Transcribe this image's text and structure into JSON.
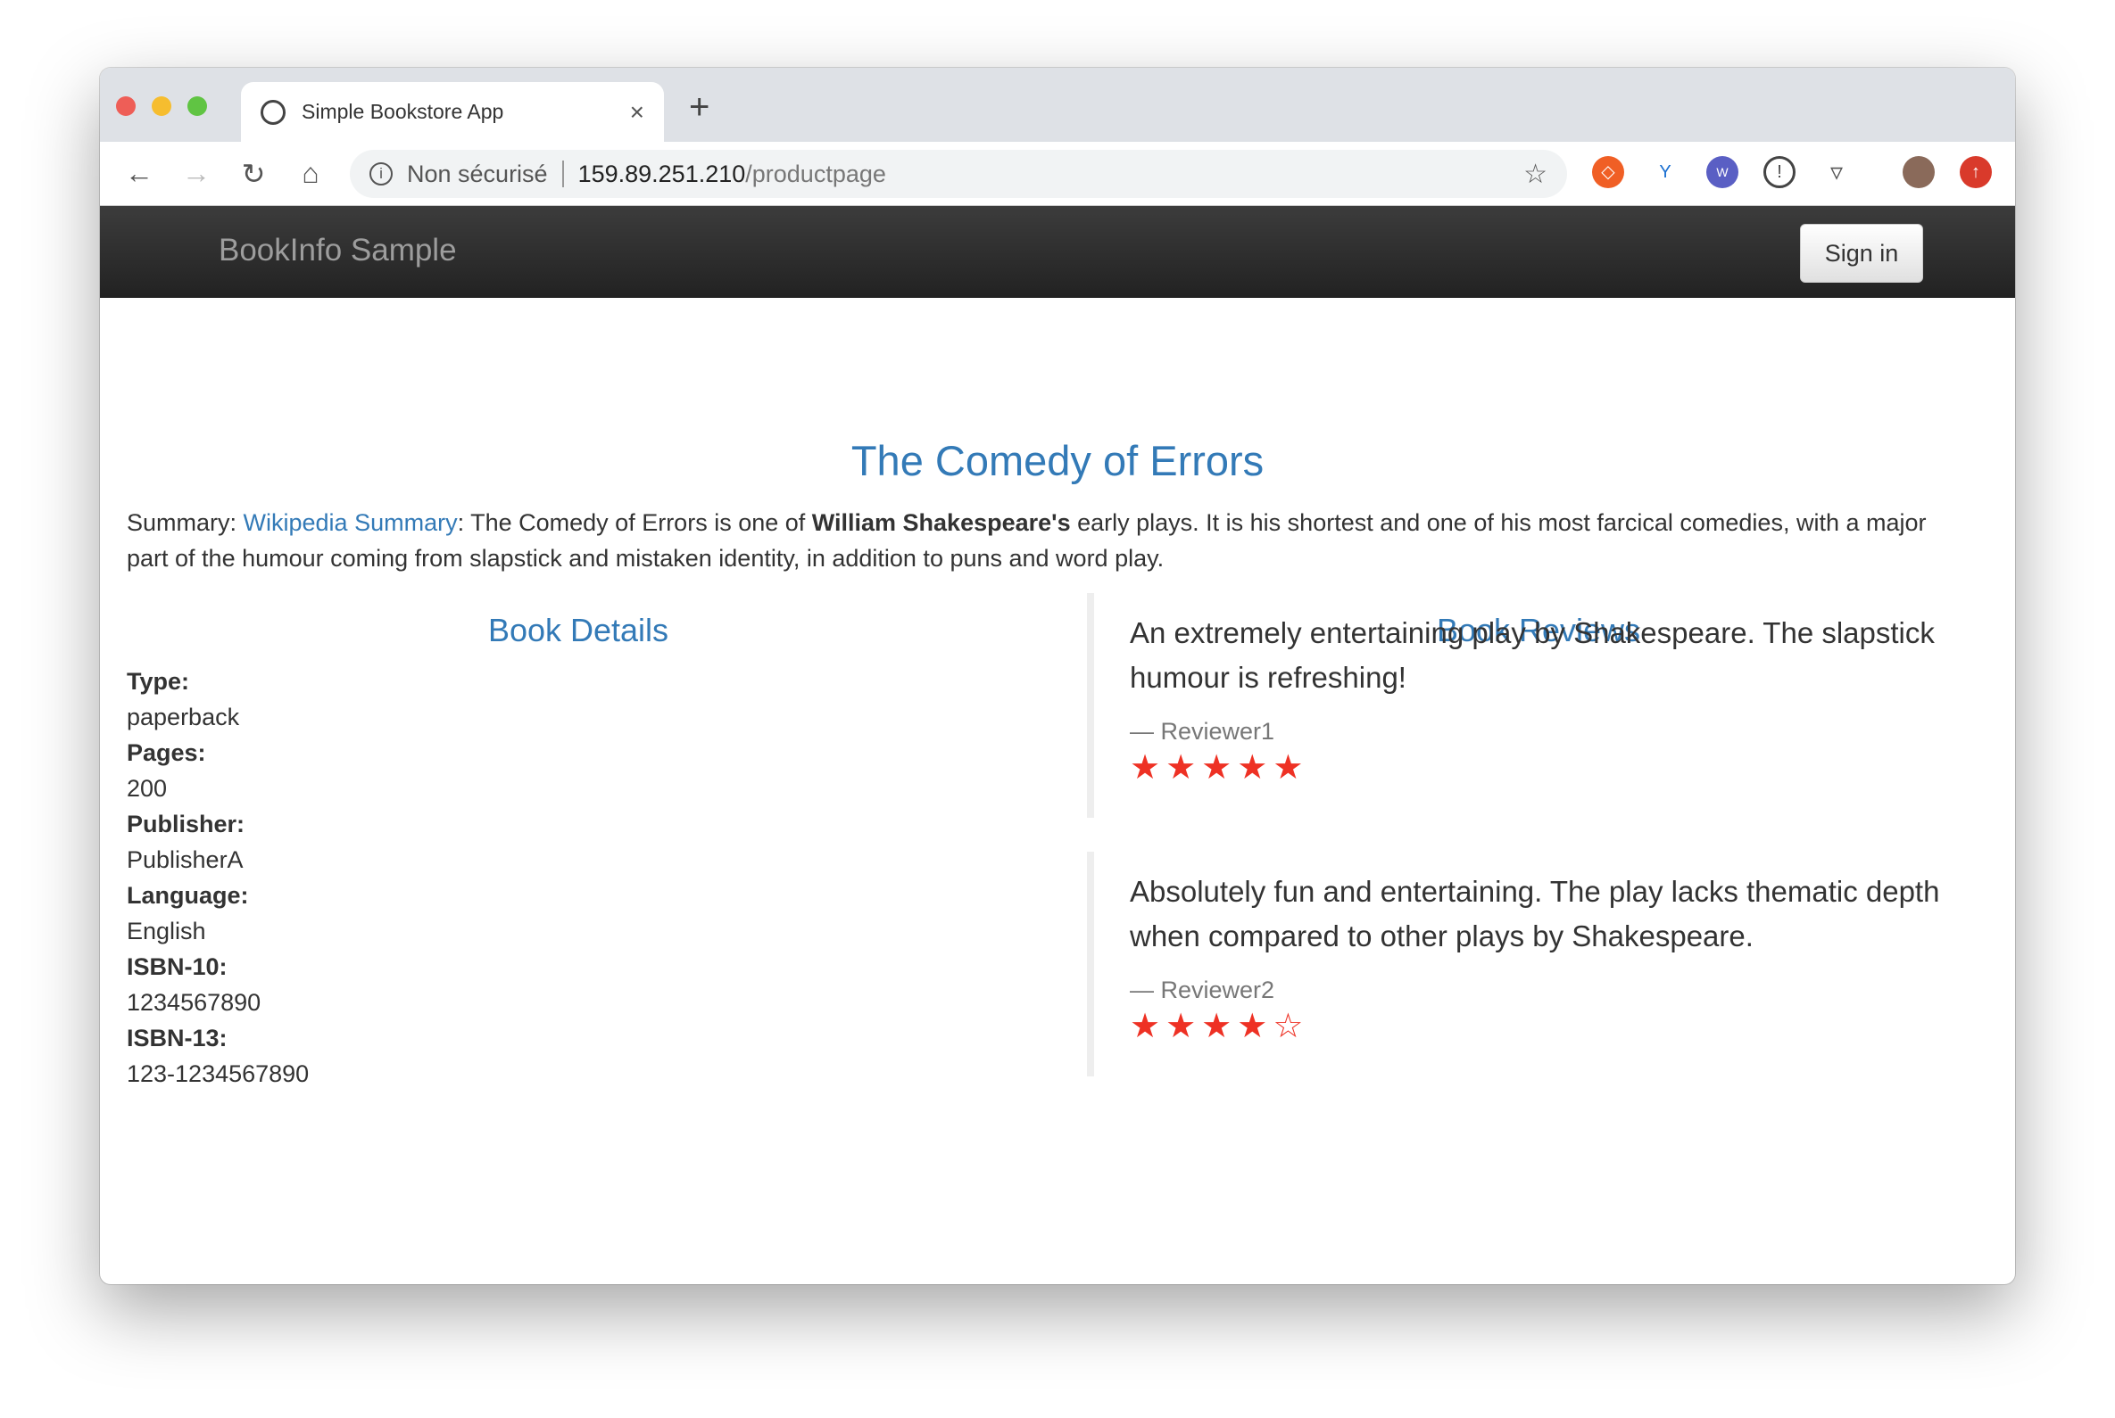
{
  "browser": {
    "tab_title": "Simple Bookstore App",
    "tab_close": "×",
    "new_tab": "+",
    "security_label": "Non sécurisé",
    "url_host": "159.89.251.210",
    "url_path": "/productpage",
    "extensions": [
      "brave-rewards-icon",
      "yoroi-icon",
      "wappalyzer-icon",
      "1password-icon",
      "pocket-icon",
      "avatar",
      "update-icon"
    ]
  },
  "navbar": {
    "brand": "BookInfo Sample",
    "sign_in": "Sign in"
  },
  "page": {
    "title": "The Comedy of Errors",
    "summary_label": "Summary: ",
    "summary_link": "Wikipedia Summary",
    "summary_pre": ": The Comedy of Errors is one of ",
    "summary_bold": "William Shakespeare's",
    "summary_post": " early plays. It is his shortest and one of his most farcical comedies, with a major part of the humour coming from slapstick and mistaken identity, in addition to puns and word play."
  },
  "details": {
    "heading": "Book Details",
    "items": [
      {
        "label": "Type:",
        "value": "paperback"
      },
      {
        "label": "Pages:",
        "value": "200"
      },
      {
        "label": "Publisher:",
        "value": "PublisherA"
      },
      {
        "label": "Language:",
        "value": "English"
      },
      {
        "label": "ISBN-10:",
        "value": "1234567890"
      },
      {
        "label": "ISBN-13:",
        "value": "123-1234567890"
      }
    ]
  },
  "reviews": {
    "heading": "Book Reviews",
    "star_color": "#ee3124",
    "items": [
      {
        "text": "An extremely entertaining play by Shakespeare. The slapstick humour is refreshing!",
        "reviewer": "— Reviewer1",
        "rating": 5,
        "max": 5
      },
      {
        "text": "Absolutely fun and entertaining. The play lacks thematic depth when compared to other plays by Shakespeare.",
        "reviewer": "— Reviewer2",
        "rating": 4,
        "max": 5
      }
    ]
  }
}
